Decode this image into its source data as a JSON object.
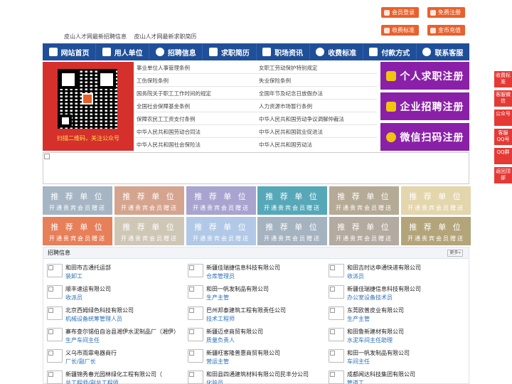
{
  "top": {
    "links": [
      "皮山人才网最新招聘信息",
      "皮山人才网最新求职简历"
    ],
    "buttons": [
      {
        "label": "会员登录"
      },
      {
        "label": "免费注册"
      },
      {
        "label": "收费标准"
      },
      {
        "label": "金币充值"
      }
    ]
  },
  "nav": [
    {
      "label": "网站首页",
      "icon": "home-icon"
    },
    {
      "label": "用人单位",
      "icon": "building-icon"
    },
    {
      "label": "招聘信息",
      "icon": "megaphone-icon"
    },
    {
      "label": "求职简历",
      "icon": "resume-icon"
    },
    {
      "label": "职场资讯",
      "icon": "news-icon"
    },
    {
      "label": "收费标准",
      "icon": "yen-icon"
    },
    {
      "label": "付款方式",
      "icon": "payment-icon"
    },
    {
      "label": "联系客服",
      "icon": "phone-icon"
    }
  ],
  "qr_caption": "扫描二维码，关注公众号",
  "laws": {
    "left": [
      "事业单位人事管理条例",
      "工伤保险条例",
      "国务院关于职工工作时间的规定",
      "全国社会保障基金条例",
      "保障农民工工资支付条例",
      "中华人民共和国劳动合同法",
      "中华人民共和国社会保险法"
    ],
    "right": [
      "女职工劳动保护特别规定",
      "失业保险条例",
      "全国年节及纪念日放假办法",
      "人力资源市场暂行条例",
      "中华人民共和国劳动争议调解仲裁法",
      "中华人民共和国就业促进法",
      "中华人民共和国劳动法"
    ]
  },
  "register": [
    {
      "label": "个人求职注册"
    },
    {
      "label": "企业招聘注册"
    },
    {
      "label": "微信扫码注册"
    }
  ],
  "recommend": {
    "title": "推 荐 单 位",
    "subtitle": "开通贵宾会员赠送",
    "colors": [
      "#a6b5c4",
      "#d5a48e",
      "#a8a4cf",
      "#56a8b8",
      "#b5aa96",
      "#e3d6ad",
      "#e77f59",
      "#cfc7b6",
      "#b1c8e6",
      "#a5b2bf",
      "#b3aaa0",
      "#b3a47a"
    ]
  },
  "jobs": {
    "title": "招聘信息",
    "more": "更多»",
    "items": [
      {
        "company": "和田市吉通托运部",
        "position": "装卸工"
      },
      {
        "company": "新疆佳瑞捷信息科技有限公司",
        "position": "仓库管理员"
      },
      {
        "company": "和田吉时达申通快递有限公司",
        "position": "收派员"
      },
      {
        "company": "顺丰速运有限公司",
        "position": "收派员"
      },
      {
        "company": "和田一帆发制品有限公司",
        "position": "生产主管"
      },
      {
        "company": "新疆佳瑞捷信息科技有限公司",
        "position": "办公室设备技术员"
      },
      {
        "company": "北京西姆绿色科技有限公司",
        "position": "机械设备统筹管理人员"
      },
      {
        "company": "巴州邦泰建筑工程有限责任公司",
        "position": "技术工程师"
      },
      {
        "company": "东莞欧普皮业有限公司",
        "position": "生产主管"
      },
      {
        "company": "寨布查尔锡伯自治县湘伊水泥制品厂（湘伊）",
        "position": "生产车间主任"
      },
      {
        "company": "新疆迈卓商贸有限公司",
        "position": "质量负责人"
      },
      {
        "company": "和田鲁新建材有限公司",
        "position": "水泥车间主任助理"
      },
      {
        "company": "义乌市雨霏电器商行",
        "position": "厂长/副厂长"
      },
      {
        "company": "新疆旺客隆普惠商贸有限公司",
        "position": "营运主管"
      },
      {
        "company": "和田一帆发制品有限公司",
        "position": "车间主任"
      },
      {
        "company": "新疆锦秀春光园林绿化工程有限公司（",
        "position": "总工程师/副总工程师"
      },
      {
        "company": "和田县四通建筑材料有限公司民丰分公司",
        "position": "化验员"
      },
      {
        "company": "成都闻达科技集团有限公司",
        "position": "管道工"
      }
    ]
  },
  "side": [
    "收费标准",
    "客服微信",
    "公众号",
    "客服QQ号",
    "QQ群",
    "返回顶部"
  ]
}
